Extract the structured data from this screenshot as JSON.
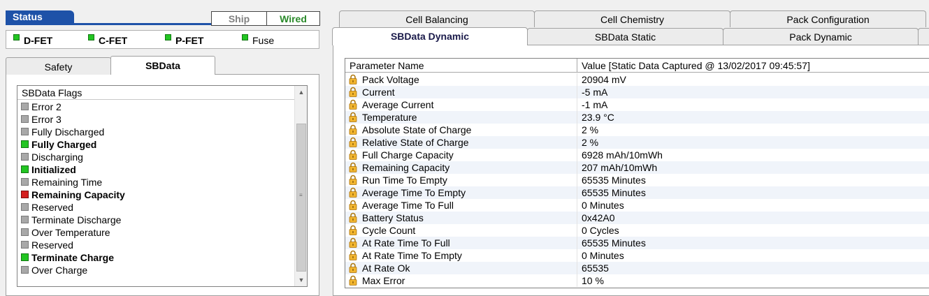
{
  "status": {
    "label": "Status",
    "modes": {
      "ship": "Ship",
      "wired": "Wired"
    },
    "fets": [
      {
        "label": "D-FET",
        "bold": true
      },
      {
        "label": "C-FET",
        "bold": true
      },
      {
        "label": "P-FET",
        "bold": true
      },
      {
        "label": "Fuse",
        "bold": false
      }
    ]
  },
  "left_tabs": {
    "safety": "Safety",
    "sbdata": "SBData"
  },
  "flags": {
    "header": "SBData Flags",
    "items": [
      {
        "label": "Error 2",
        "state": "off"
      },
      {
        "label": "Error 3",
        "state": "off"
      },
      {
        "label": "Fully Discharged",
        "state": "off"
      },
      {
        "label": "Fully Charged",
        "state": "on"
      },
      {
        "label": "Discharging",
        "state": "off"
      },
      {
        "label": "Initialized",
        "state": "on"
      },
      {
        "label": "Remaining Time",
        "state": "off"
      },
      {
        "label": "Remaining Capacity",
        "state": "warn"
      },
      {
        "label": "Reserved",
        "state": "off"
      },
      {
        "label": "Terminate Discharge",
        "state": "off"
      },
      {
        "label": "Over Temperature",
        "state": "off"
      },
      {
        "label": "Reserved",
        "state": "off"
      },
      {
        "label": "Terminate Charge",
        "state": "on"
      },
      {
        "label": "Over Charge",
        "state": "off"
      }
    ]
  },
  "right_tabs": {
    "row1": [
      "Cell Balancing",
      "Cell Chemistry",
      "Pack Configuration"
    ],
    "row2": [
      "SBData Dynamic",
      "SBData Static",
      "Pack Dynamic"
    ]
  },
  "grid": {
    "col_param": "Parameter Name",
    "col_value": "Value [Static Data Captured @ 13/02/2017 09:45:57]",
    "rows": [
      {
        "name": "Pack Voltage",
        "value": "20904 mV"
      },
      {
        "name": "Current",
        "value": "-5 mA"
      },
      {
        "name": "Average Current",
        "value": "-1 mA"
      },
      {
        "name": "Temperature",
        "value": "23.9 °C"
      },
      {
        "name": "Absolute State of Charge",
        "value": "2 %"
      },
      {
        "name": "Relative State of Charge",
        "value": "2 %"
      },
      {
        "name": "Full Charge Capacity",
        "value": "6928 mAh/10mWh"
      },
      {
        "name": "Remaining Capacity",
        "value": "207 mAh/10mWh"
      },
      {
        "name": "Run Time To Empty",
        "value": "65535 Minutes"
      },
      {
        "name": "Average Time To Empty",
        "value": "65535 Minutes"
      },
      {
        "name": "Average Time To Full",
        "value": "0 Minutes"
      },
      {
        "name": "Battery Status",
        "value": "0x42A0"
      },
      {
        "name": "Cycle Count",
        "value": "0 Cycles"
      },
      {
        "name": "At Rate Time To Full",
        "value": "65535 Minutes"
      },
      {
        "name": "At Rate Time To Empty",
        "value": "0 Minutes"
      },
      {
        "name": "At Rate Ok",
        "value": "65535"
      },
      {
        "name": "Max Error",
        "value": "10 %"
      }
    ]
  },
  "colors": {
    "status_blue": "#1e52a8",
    "indicator_on": "#22c522",
    "indicator_off": "#a8a8a8",
    "indicator_warn": "#d51f1f",
    "wired_green": "#2a8a2a"
  }
}
